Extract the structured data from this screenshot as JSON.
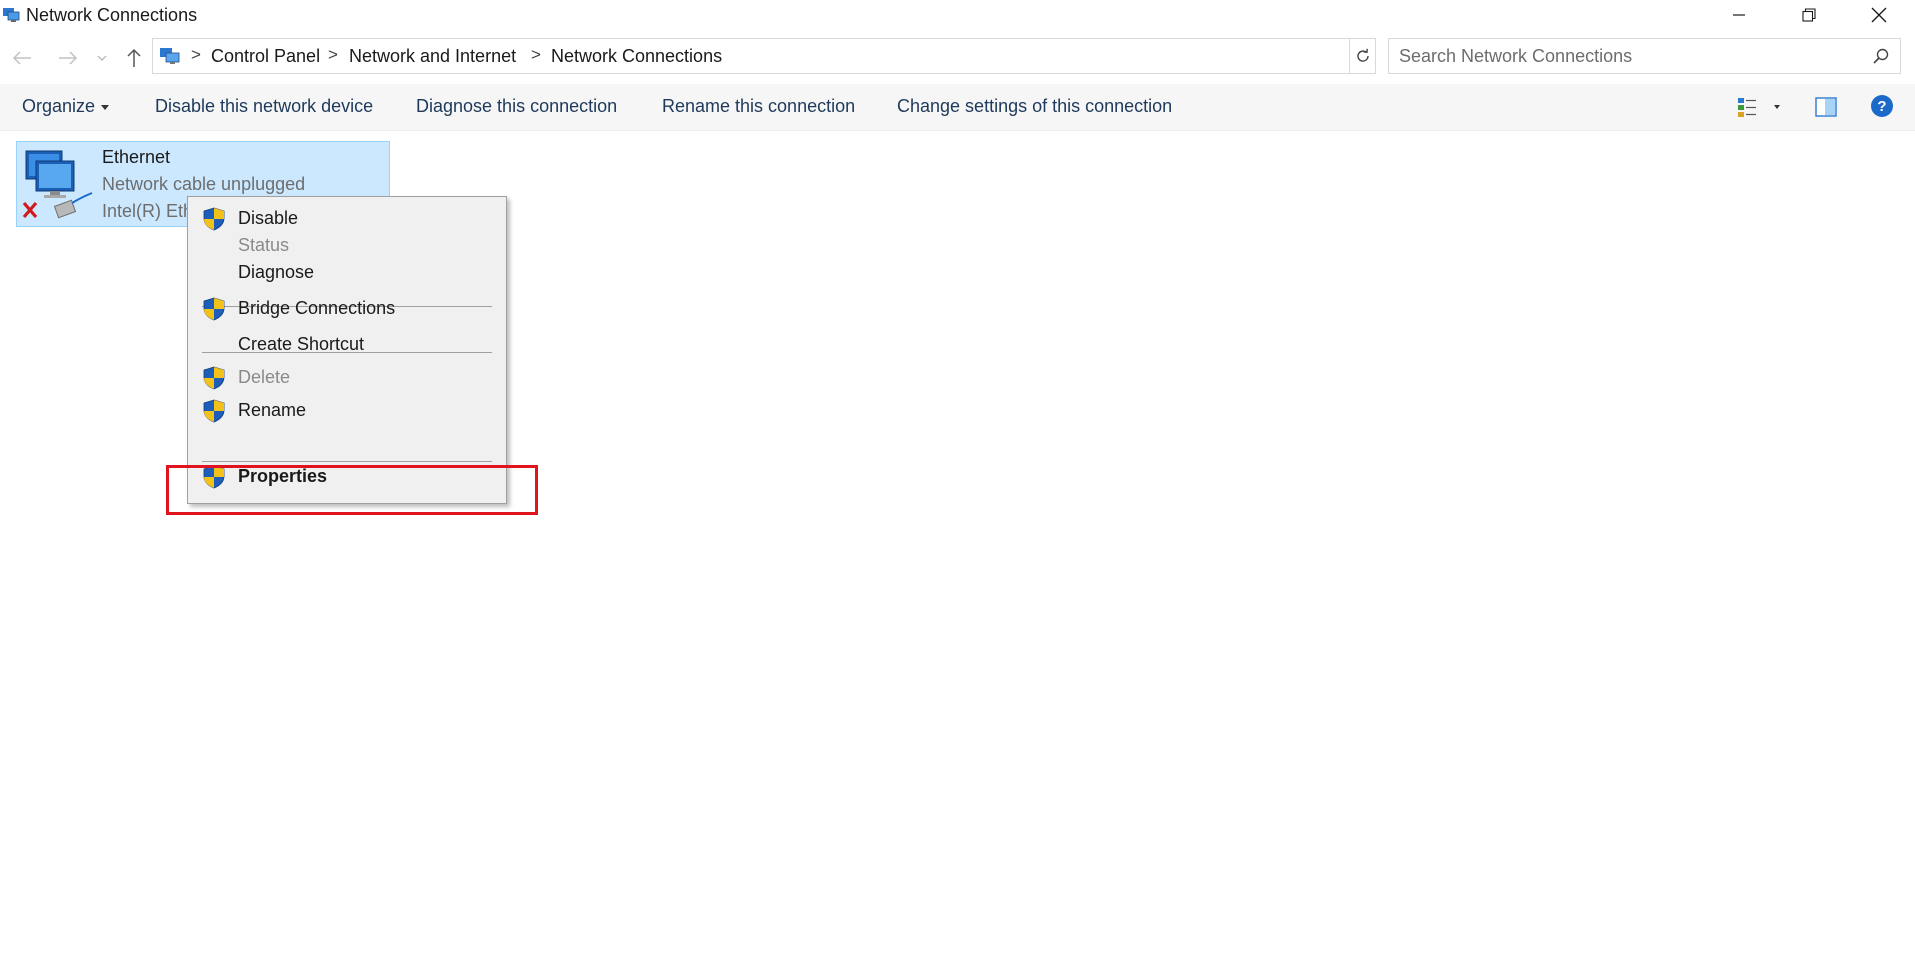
{
  "window": {
    "title": "Network Connections"
  },
  "address_bar": {
    "breadcrumbs": [
      "Control Panel",
      "Network and Internet",
      "Network Connections"
    ],
    "separator": ">"
  },
  "search": {
    "placeholder": "Search Network Connections"
  },
  "command_bar": {
    "organize_label": "Organize",
    "disable_label": "Disable this network device",
    "diagnose_label": "Diagnose this connection",
    "rename_label": "Rename this connection",
    "change_label": "Change settings of this connection",
    "help_label": "?"
  },
  "connection": {
    "name": "Ethernet",
    "status": "Network cable unplugged",
    "device": "Intel(R) Eth",
    "selected": true
  },
  "context_menu": {
    "items": [
      {
        "label": "Disable",
        "shield": true,
        "enabled": true
      },
      {
        "label": "Status",
        "shield": false,
        "enabled": false
      },
      {
        "label": "Diagnose",
        "shield": false,
        "enabled": true
      },
      {
        "label": "Bridge Connections",
        "shield": true,
        "enabled": true
      },
      {
        "label": "Create Shortcut",
        "shield": false,
        "enabled": true
      },
      {
        "label": "Delete",
        "shield": true,
        "enabled": false
      },
      {
        "label": "Rename",
        "shield": true,
        "enabled": true
      },
      {
        "label": "Properties",
        "shield": true,
        "enabled": true,
        "default": true
      }
    ]
  },
  "colors": {
    "selection_bg": "#cce8ff",
    "highlight_box": "#e0141e",
    "link_text": "#1e395b",
    "help_icon": "#1b6ac9"
  }
}
